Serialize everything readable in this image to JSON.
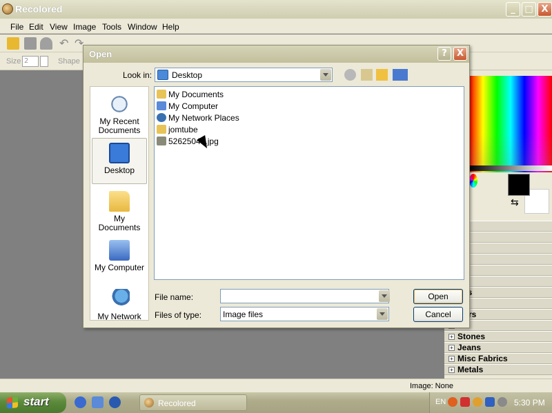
{
  "app": {
    "title": "Recolored",
    "window_buttons": {
      "minimize": "_",
      "maximize": "□",
      "close": "X"
    }
  },
  "menu": [
    "File",
    "Edit",
    "View",
    "Image",
    "Tools",
    "Window",
    "Help"
  ],
  "toolbar2": {
    "size_label": "Size",
    "size_value": "2",
    "shape_label": "Shape"
  },
  "dialog": {
    "title": "Open",
    "help_label": "?",
    "close_label": "X",
    "look_in_label": "Look in:",
    "look_in_value": "Desktop",
    "places": [
      {
        "label": "My Recent Documents",
        "icon": "recent-documents-icon"
      },
      {
        "label": "Desktop",
        "icon": "desktop-icon",
        "selected": true
      },
      {
        "label": "My Documents",
        "icon": "my-documents-icon"
      },
      {
        "label": "My Computer",
        "icon": "my-computer-icon"
      },
      {
        "label": "My Network",
        "icon": "my-network-icon"
      }
    ],
    "files": [
      {
        "name": "My Documents",
        "icon": "folder-icon"
      },
      {
        "name": "My Computer",
        "icon": "computer-icon"
      },
      {
        "name": "My Network Places",
        "icon": "network-icon"
      },
      {
        "name": "jomtube",
        "icon": "folder-icon"
      },
      {
        "name": "52625048.jpg",
        "icon": "jpg-file-icon"
      }
    ],
    "file_name_label": "File name:",
    "file_name_value": "",
    "files_of_type_label": "Files of type:",
    "files_of_type_value": "Image files",
    "open_button": "Open",
    "cancel_button": "Cancel"
  },
  "right_panel": {
    "categories": [
      "h",
      "r",
      "s",
      "s",
      "ter",
      "",
      "uds",
      "ss",
      "wers",
      "od",
      "Stones",
      "Jeans",
      "Misc Fabrics",
      "Metals"
    ]
  },
  "status": {
    "text": "Image: None"
  },
  "taskbar": {
    "start_label": "start",
    "task_label": "Recolored",
    "language": "EN",
    "clock": "5:30 PM"
  }
}
